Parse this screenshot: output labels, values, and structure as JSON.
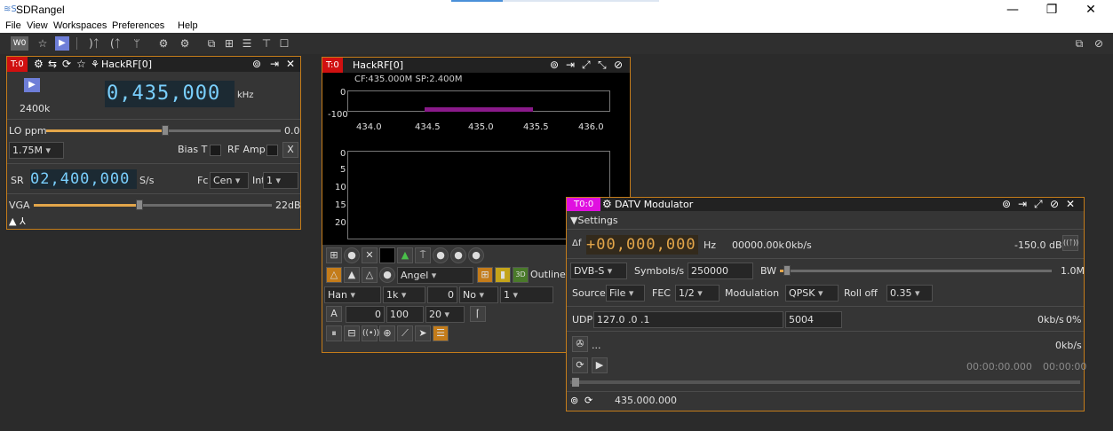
{
  "window": {
    "title": "SDRangel",
    "app_icon": "≋S",
    "minimize_icon": "—",
    "maximize_icon": "❐",
    "close_icon": "✕"
  },
  "menu": {
    "items": [
      "File",
      "View",
      "Workspaces",
      "Preferences",
      "Help"
    ]
  },
  "workspace_toolbar": {
    "workspace_label": "W0"
  },
  "hackrf_device": {
    "tag": "T:0",
    "title": "HackRF[0]",
    "sample_rate_label": "2400k",
    "frequency": "0,435,000",
    "frequency_unit": "kHz",
    "lo_ppm_label": "LO ppm",
    "lo_ppm_value": "0.0",
    "bbf_value": "1.75M",
    "bias_t_label": "Bias T",
    "rf_amp_label": "RF Amp",
    "x_label": "X",
    "sr_label": "SR",
    "sr_value": "02,400,000",
    "sr_unit": "S/s",
    "fc_label": "Fc",
    "fc_value": "Cen",
    "int_label": "Int",
    "int_value": "1",
    "vga_label": "VGA",
    "vga_value": "22dB"
  },
  "spectrum": {
    "tag": "T:0",
    "title": "HackRF[0]",
    "info": "CF:435.000M SP:2.400M",
    "y_ticks_top": [
      "0",
      "-100"
    ],
    "x_ticks": [
      "434.0",
      "434.5",
      "435.0",
      "435.5",
      "436.0"
    ],
    "y_ticks_waterfall": [
      "0",
      "5",
      "10",
      "15",
      "20"
    ],
    "palette": "Angel",
    "outline_label": "Outline",
    "window_fn": "Han",
    "fft_size": "1k",
    "overlap": "0",
    "averaging": "No",
    "avg_count": "1",
    "ref_mode": "A",
    "ref_value": "0",
    "range_value": "100",
    "fps": "20",
    "colors": {
      "bar": "#8a1a8a"
    }
  },
  "datv_modulator": {
    "tag": "T0:0",
    "title": "DATV Modulator",
    "settings_label": "▼Settings",
    "delta_symbol": "Δf",
    "offset": "+00,000,000",
    "offset_unit": "Hz",
    "bandwidth_readout": "00000.00k",
    "rate_readout": "0kb/s",
    "power": "-150.0 dB",
    "standard": "DVB-S",
    "symbol_rate_label": "Symbols/s",
    "symbol_rate": "250000",
    "bw_label": "BW",
    "bw_value": "1.0M",
    "source_label": "Source",
    "source_value": "File",
    "fec_label": "FEC",
    "fec_value": "1/2",
    "modulation_label": "Modulation",
    "modulation_value": "QPSK",
    "rolloff_label": "Roll off",
    "rolloff_value": "0.35",
    "udp_label": "UDP",
    "udp_address": "127.0 .0 .1",
    "udp_port": "5004",
    "udp_rate": "0kb/s",
    "udp_pct": "0%",
    "file_name": "...",
    "file_rate": "0kb/s",
    "time_elapsed": "00:00:00.000",
    "time_total": "00:00:00",
    "center_freq": "435.000.000"
  }
}
